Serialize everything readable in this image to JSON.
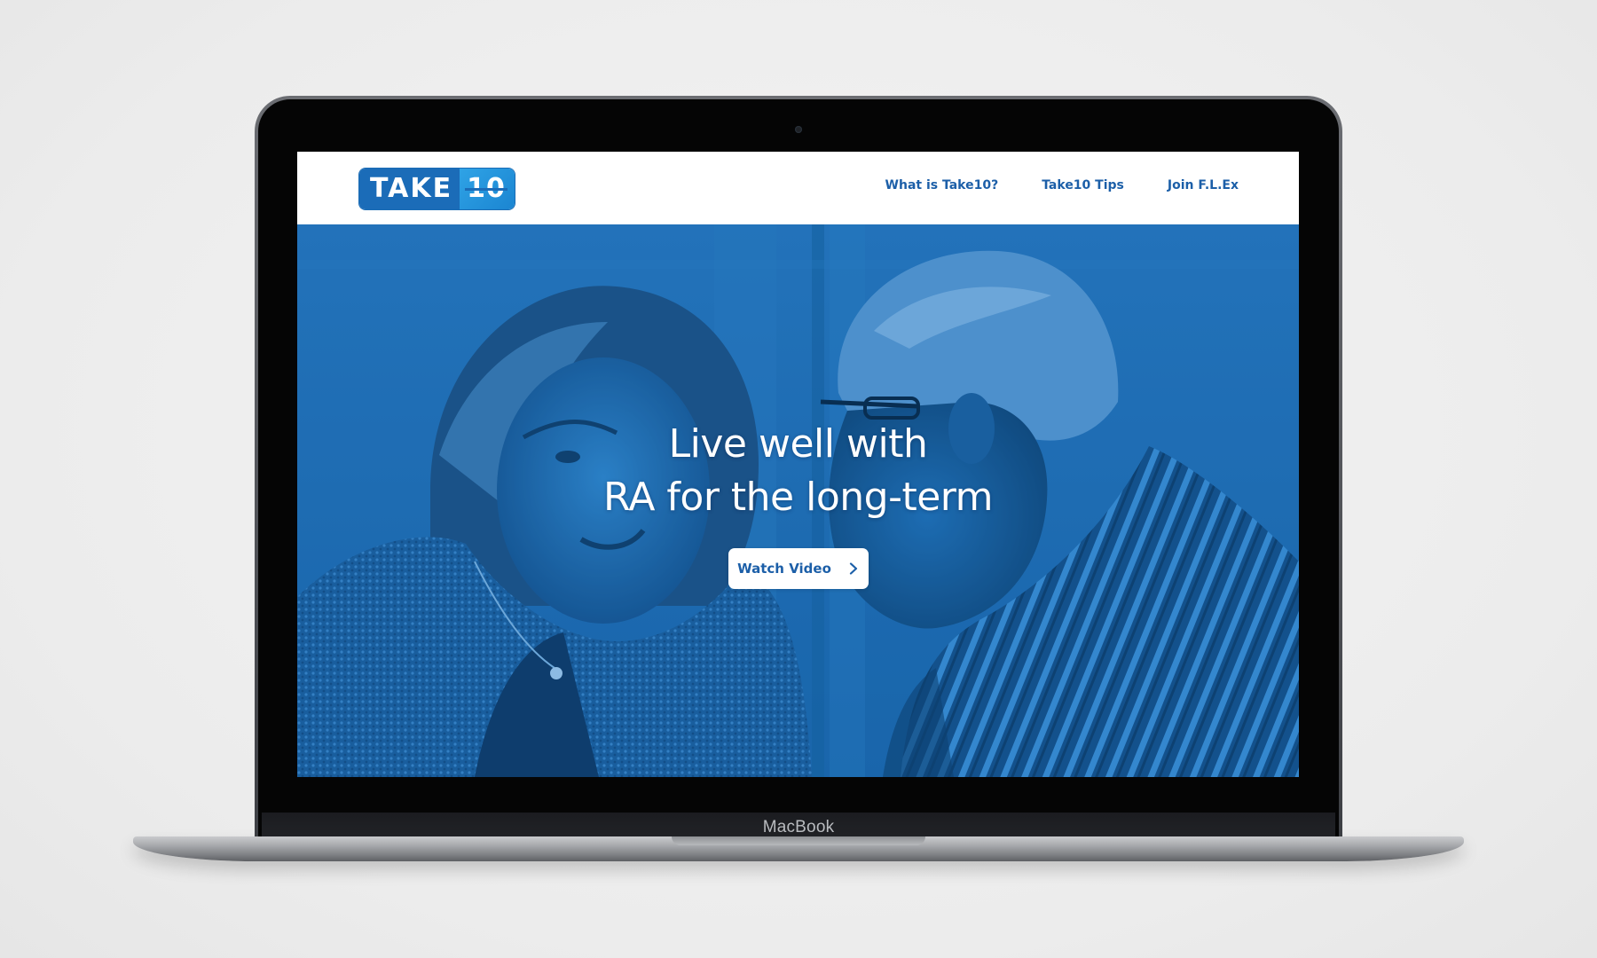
{
  "device": {
    "brand_label": "MacBook"
  },
  "site": {
    "logo": {
      "word": "TAKE",
      "number": "10"
    },
    "nav": {
      "items": [
        {
          "label": "What is Take10?"
        },
        {
          "label": "Take10 Tips"
        },
        {
          "label": "Join F.L.Ex"
        }
      ]
    },
    "hero": {
      "headline_line1": "Live well with",
      "headline_line2": "RA for the long-term",
      "cta_label": "Watch Video",
      "cta_icon": "chevron-right-icon"
    }
  },
  "colors": {
    "brand_blue": "#1b6cb8",
    "accent_blue": "#2fa3e6",
    "hero_tint": "#1a67ac",
    "nav_text": "#1c5fa8"
  }
}
